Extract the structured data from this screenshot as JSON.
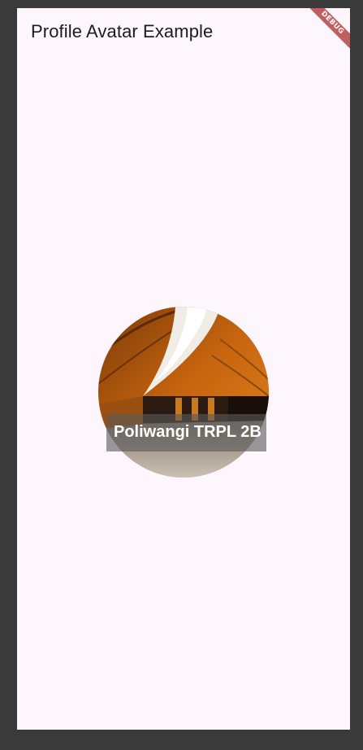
{
  "appbar": {
    "title": "Profile Avatar Example"
  },
  "debug_banner": {
    "label": "DEBUG"
  },
  "avatar": {
    "image_description_icon": "avatar-photo",
    "caption": "Poliwangi TRPL 2B"
  },
  "colors": {
    "background": "#fdf6fd",
    "outer_frame": "#3a3a3a",
    "debug_banner": "#a82424",
    "caption_overlay": "#5a5a5a"
  }
}
